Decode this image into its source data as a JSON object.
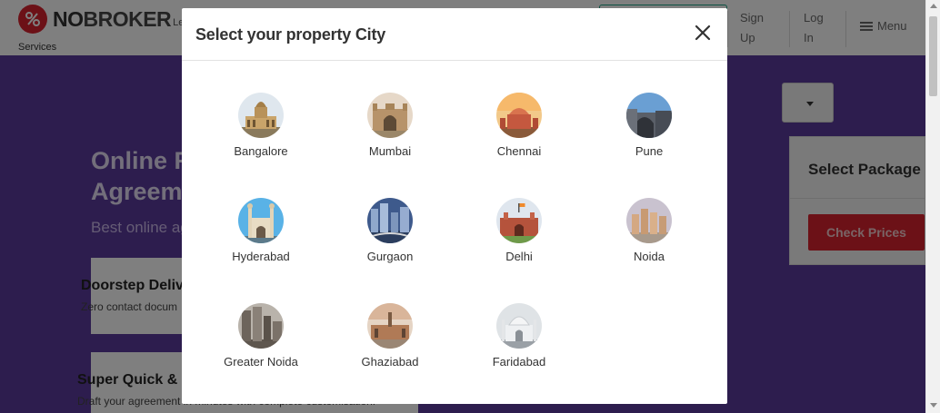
{
  "header": {
    "logo_text_bold": "NO",
    "logo_text_rest": "BROKER",
    "logo_suffix": "Le",
    "services_label": "Services",
    "sign_up_line1": "Sign",
    "sign_up_line2": "Up",
    "log_in_line1": "Log",
    "log_in_line2": "In",
    "menu_label": "Menu",
    "brand_color": "#d8222f"
  },
  "hero": {
    "title_line1": "Online R",
    "title_line2": "Agreem",
    "subtitle": "Best online ag",
    "background_color": "#5b3a9c",
    "features": [
      {
        "title": "Doorstep Delive",
        "desc": "Zero contact docum"
      },
      {
        "title": "Super Quick & E",
        "desc": "Draft your agreement in minutes with complete customisation."
      }
    ]
  },
  "package": {
    "title": "Select Package",
    "button_label": "Check Prices",
    "button_color": "#d8222f"
  },
  "modal": {
    "title": "Select your property City",
    "close_icon": "close-icon",
    "cities": [
      {
        "name": "Bangalore",
        "icon": "bangalore-landmark-icon"
      },
      {
        "name": "Mumbai",
        "icon": "mumbai-landmark-icon"
      },
      {
        "name": "Chennai",
        "icon": "chennai-landmark-icon"
      },
      {
        "name": "Pune",
        "icon": "pune-landmark-icon"
      },
      {
        "name": "Hyderabad",
        "icon": "hyderabad-landmark-icon"
      },
      {
        "name": "Gurgaon",
        "icon": "gurgaon-landmark-icon"
      },
      {
        "name": "Delhi",
        "icon": "delhi-landmark-icon"
      },
      {
        "name": "Noida",
        "icon": "noida-landmark-icon"
      },
      {
        "name": "Greater Noida",
        "icon": "greater-noida-landmark-icon"
      },
      {
        "name": "Ghaziabad",
        "icon": "ghaziabad-landmark-icon"
      },
      {
        "name": "Faridabad",
        "icon": "faridabad-landmark-icon"
      }
    ]
  }
}
